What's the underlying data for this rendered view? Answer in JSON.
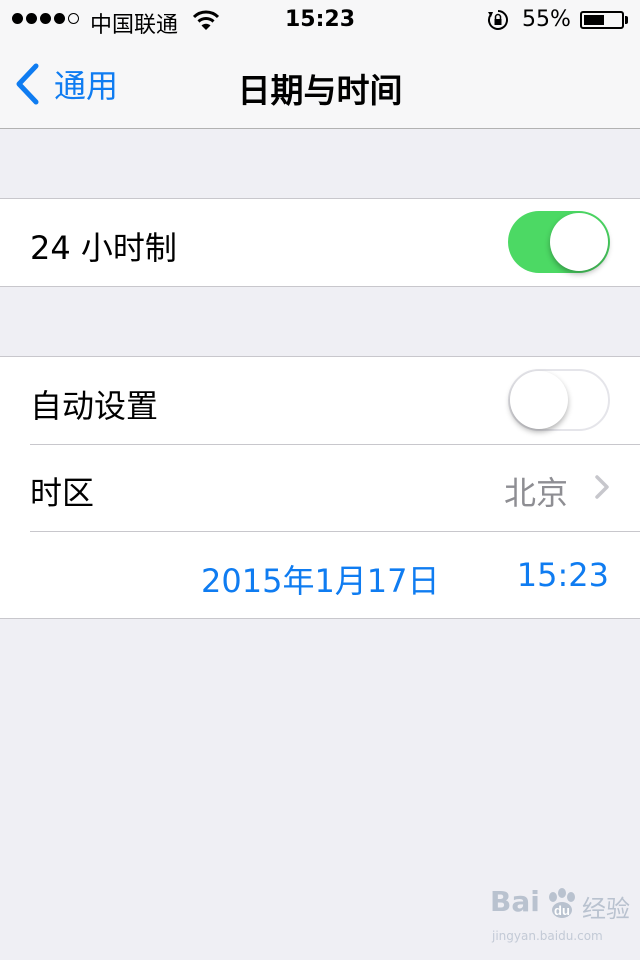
{
  "status_bar": {
    "signal_bars": 5,
    "signal_filled": 4,
    "carrier": "中国联通",
    "wifi_icon": "wifi-icon",
    "time": "15:23",
    "rotation_lock_icon": "rotation-lock-icon",
    "battery_percent_text": "55%",
    "battery_level": 0.55
  },
  "nav": {
    "back_label": "通用",
    "title": "日期与时间"
  },
  "settings": {
    "hour24": {
      "label": "24 小时制",
      "on": true
    },
    "auto_set": {
      "label": "自动设置",
      "on": false
    },
    "timezone": {
      "label": "时区",
      "value": "北京"
    },
    "datetime": {
      "date": "2015年1月17日",
      "time": "15:23"
    }
  },
  "watermark": {
    "logo_text": "Bai",
    "logo_text2": "经验",
    "url": "jingyan.baidu.com"
  },
  "colors": {
    "accent": "#0f7cf1",
    "toggle_on": "#4cd964",
    "background": "#efeff4"
  }
}
